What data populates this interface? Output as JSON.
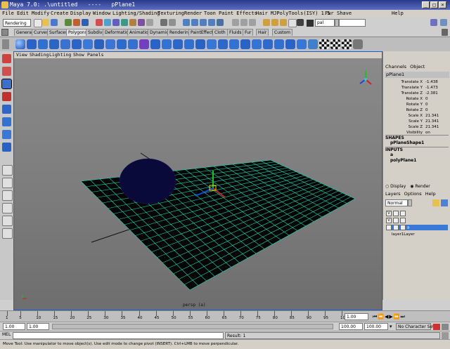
{
  "window": {
    "title": "Maya 7.0: .\\untitled   ----   pPlane1"
  },
  "menubar": {
    "items": [
      "File",
      "Edit",
      "Modify",
      "Create",
      "Display",
      "Window",
      "Lighting/Shading",
      "Texturing",
      "Render",
      "Toon",
      "Paint Effects",
      "Hair",
      "MJPolyTools(ISY) 1.5",
      "Fur",
      "Shave",
      "Help"
    ]
  },
  "statusline": {
    "mode": "Rendering",
    "field_label": "pal"
  },
  "shelf": {
    "tabs": [
      "General",
      "Curves",
      "Surfaces",
      "Polygons",
      "Subdivs",
      "Deformation",
      "Animation",
      "Dynamics",
      "Rendering",
      "PaintEffects",
      "Cloth",
      "Fluids",
      "Fur",
      "Hair",
      "Custom"
    ],
    "active_tab": "Polygons"
  },
  "viewport": {
    "menu": [
      "View",
      "Shading",
      "Lighting",
      "Show",
      "Panels"
    ],
    "camera_label": "persp (a)",
    "colors": {
      "grid": "#1fd6b4",
      "plane": "#050505",
      "sphere": "#0a0a3a"
    }
  },
  "channel_box": {
    "menu": [
      "Channels",
      "Object"
    ],
    "object": "pPlane1",
    "attributes": [
      {
        "name": "Translate X",
        "value": "-1.438"
      },
      {
        "name": "Translate Y",
        "value": "-1.473"
      },
      {
        "name": "Translate Z",
        "value": "-2.381"
      },
      {
        "name": "Rotate X",
        "value": "0"
      },
      {
        "name": "Rotate Y",
        "value": "0"
      },
      {
        "name": "Rotate Z",
        "value": "0"
      },
      {
        "name": "Scale X",
        "value": "21.341"
      },
      {
        "name": "Scale Y",
        "value": "21.341"
      },
      {
        "name": "Scale Z",
        "value": "21.341"
      },
      {
        "name": "Visibility",
        "value": "on"
      }
    ],
    "shapes_label": "SHAPES",
    "shape_name": "pPlaneShape1",
    "inputs_label": "INPUTS",
    "inputs": [
      "a",
      "polyPlane1"
    ]
  },
  "layers": {
    "display_label": "Display",
    "render_label": "Render",
    "menu": [
      "Layers",
      "Options",
      "Help"
    ],
    "blend_mode": "Normal",
    "rows": [
      {
        "flags": "V",
        "name": ""
      },
      {
        "flags": "V",
        "name": ""
      },
      {
        "flags": "V",
        "name": "a"
      }
    ],
    "default_layer": "layer1Layer"
  },
  "timeline": {
    "ticks": [
      "1",
      "5",
      "10",
      "15",
      "20",
      "25",
      "30",
      "35",
      "40",
      "45",
      "50",
      "55",
      "60",
      "65",
      "70",
      "75",
      "80",
      "85",
      "90",
      "95",
      "100"
    ],
    "current_frame": "1.00"
  },
  "range": {
    "start": "1.00",
    "start2": "1.00",
    "end": "100.00",
    "end2": "100.00",
    "character_set": "No Character Set"
  },
  "command": {
    "mel_label": "MEL",
    "result": "Result: 1"
  },
  "help_line": "Move Tool: Use manipulator to move object(s). Use edit mode to change pivot (INSERT). Ctrl+LMB to move perpendicular."
}
